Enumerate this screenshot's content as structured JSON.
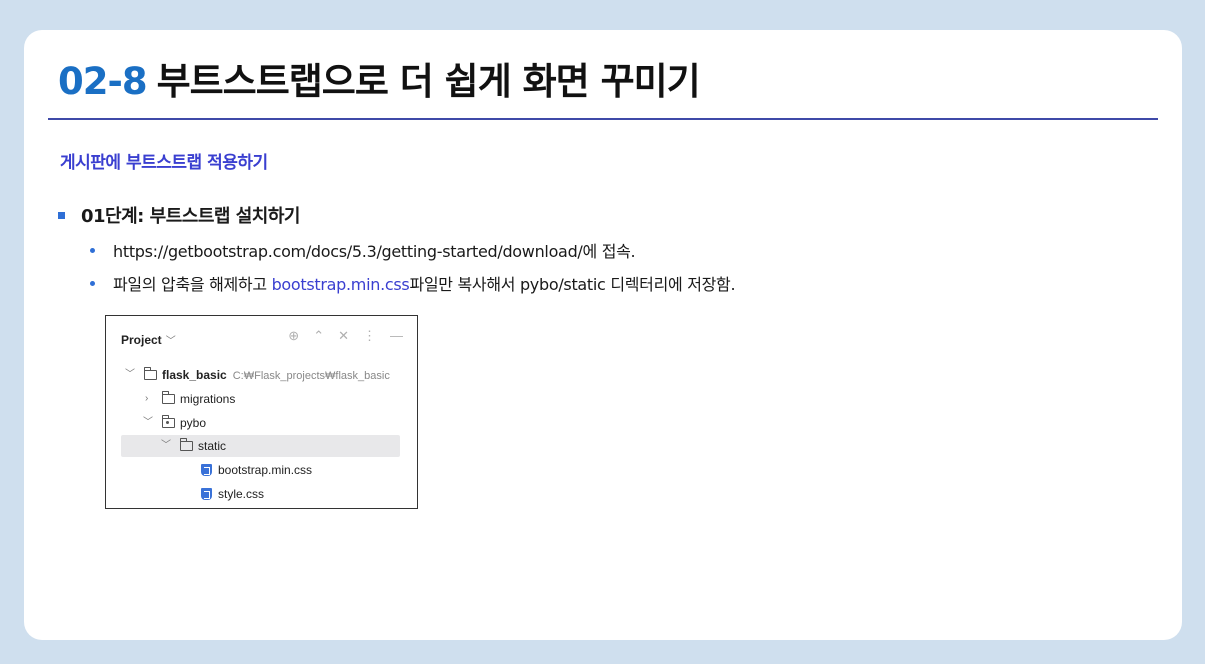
{
  "slide": {
    "title_number": "02-8",
    "title_text": "부트스트랩으로 더 쉽게 화면 꾸미기",
    "subtitle": "게시판에 부트스트랩 적용하기",
    "step": "01단계: 부트스트랩 설치하기",
    "bullets": [
      {
        "text": "https://getbootstrap.com/docs/5.3/getting-started/download/에 접속."
      },
      {
        "before": "파일의 압축을 해제하고 ",
        "link": "bootstrap.min.css",
        "after": "파일만 복사해서 pybo/static 디렉터리에 저장함."
      }
    ],
    "colors": {
      "accent": "#1a6fc4",
      "subtitle": "#3a3fd0",
      "rule": "#3f4aa8",
      "background": "#cfdfee"
    }
  },
  "project_panel": {
    "title": "Project",
    "title_chevron": "chevron-down-icon",
    "tools": [
      "⊕",
      "⌃",
      "✕",
      "⋮",
      "—"
    ],
    "tree": [
      {
        "label": "flask_basic",
        "path": "C:₩Flask_projects₩flask_basic",
        "expanded": true,
        "icon": "folder-icon"
      },
      {
        "label": "migrations",
        "expanded": false,
        "icon": "folder-icon"
      },
      {
        "label": "pybo",
        "expanded": true,
        "icon": "package-folder-icon"
      },
      {
        "label": "static",
        "expanded": true,
        "icon": "folder-icon",
        "selected": true
      },
      {
        "label": "bootstrap.min.css",
        "icon": "css-file-icon"
      },
      {
        "label": "style.css",
        "icon": "css-file-icon"
      }
    ]
  }
}
